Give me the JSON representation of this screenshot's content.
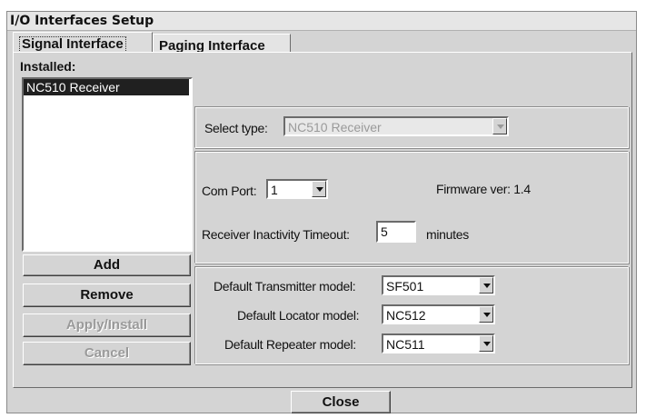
{
  "window": {
    "title": "I/O Interfaces Setup"
  },
  "tabs": [
    {
      "label": "Signal Interface",
      "active": true
    },
    {
      "label": "Paging Interface",
      "active": false
    }
  ],
  "installed": {
    "label": "Installed:",
    "items": [
      "NC510 Receiver"
    ],
    "selected_index": 0
  },
  "buttons": {
    "add": "Add",
    "remove": "Remove",
    "apply_install": "Apply/Install",
    "cancel": "Cancel",
    "close": "Close"
  },
  "select_type": {
    "label": "Select type:",
    "value": "NC510 Receiver",
    "enabled": false
  },
  "com_port": {
    "label": "Com Port:",
    "value": "1"
  },
  "firmware": {
    "text": "Firmware ver: 1.4"
  },
  "receiver_timeout": {
    "label": "Receiver Inactivity Timeout:",
    "value": "5",
    "unit": "minutes"
  },
  "defaults": {
    "transmitter": {
      "label": "Default Transmitter model:",
      "value": "SF501"
    },
    "locator": {
      "label": "Default Locator model:",
      "value": "NC512"
    },
    "repeater": {
      "label": "Default Repeater model:",
      "value": "NC511"
    }
  },
  "icons": [
    "dropdown-arrow-icon"
  ]
}
